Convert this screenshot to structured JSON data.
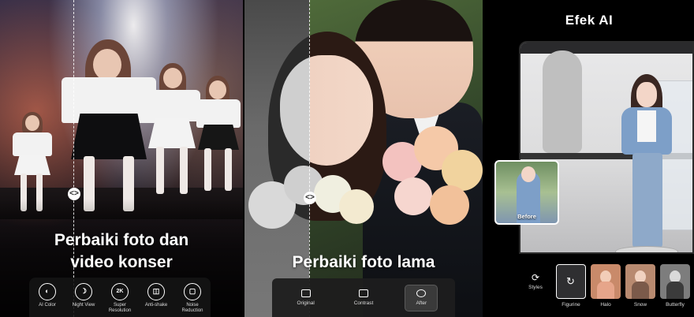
{
  "panel1": {
    "caption_line1": "Perbaiki foto dan",
    "caption_line2": "video konser",
    "divider_handle": "<>",
    "tools": [
      {
        "icon": "palette-icon",
        "glyph": "◐",
        "label": "AI Color"
      },
      {
        "icon": "moon-icon",
        "glyph": "☽",
        "label": "Night View"
      },
      {
        "icon": "2k-icon",
        "glyph": "2K",
        "label": "Super Resolution"
      },
      {
        "icon": "antishake-icon",
        "glyph": "◫",
        "label": "Anti-shake"
      },
      {
        "icon": "noise-icon",
        "glyph": "▢",
        "label": "Noise Reduction"
      }
    ]
  },
  "panel2": {
    "caption": "Perbaiki foto lama",
    "divider_handle": "<>",
    "buttons": [
      {
        "icon": "original-icon",
        "label": "Original",
        "active": false
      },
      {
        "icon": "contrast-icon",
        "label": "Contrast",
        "active": false
      },
      {
        "icon": "after-icon",
        "label": "After",
        "active": true
      }
    ]
  },
  "panel3": {
    "title": "Efek AI",
    "before_label": "Before",
    "styles_label": "Styles",
    "styles_icon": "⟳",
    "styles": [
      {
        "name": "Figurine",
        "selected": true,
        "icon": "refresh-icon",
        "glyph": "↻"
      },
      {
        "name": "Halo",
        "selected": false
      },
      {
        "name": "Snow",
        "selected": false
      },
      {
        "name": "Butterfly",
        "selected": false
      }
    ]
  }
}
